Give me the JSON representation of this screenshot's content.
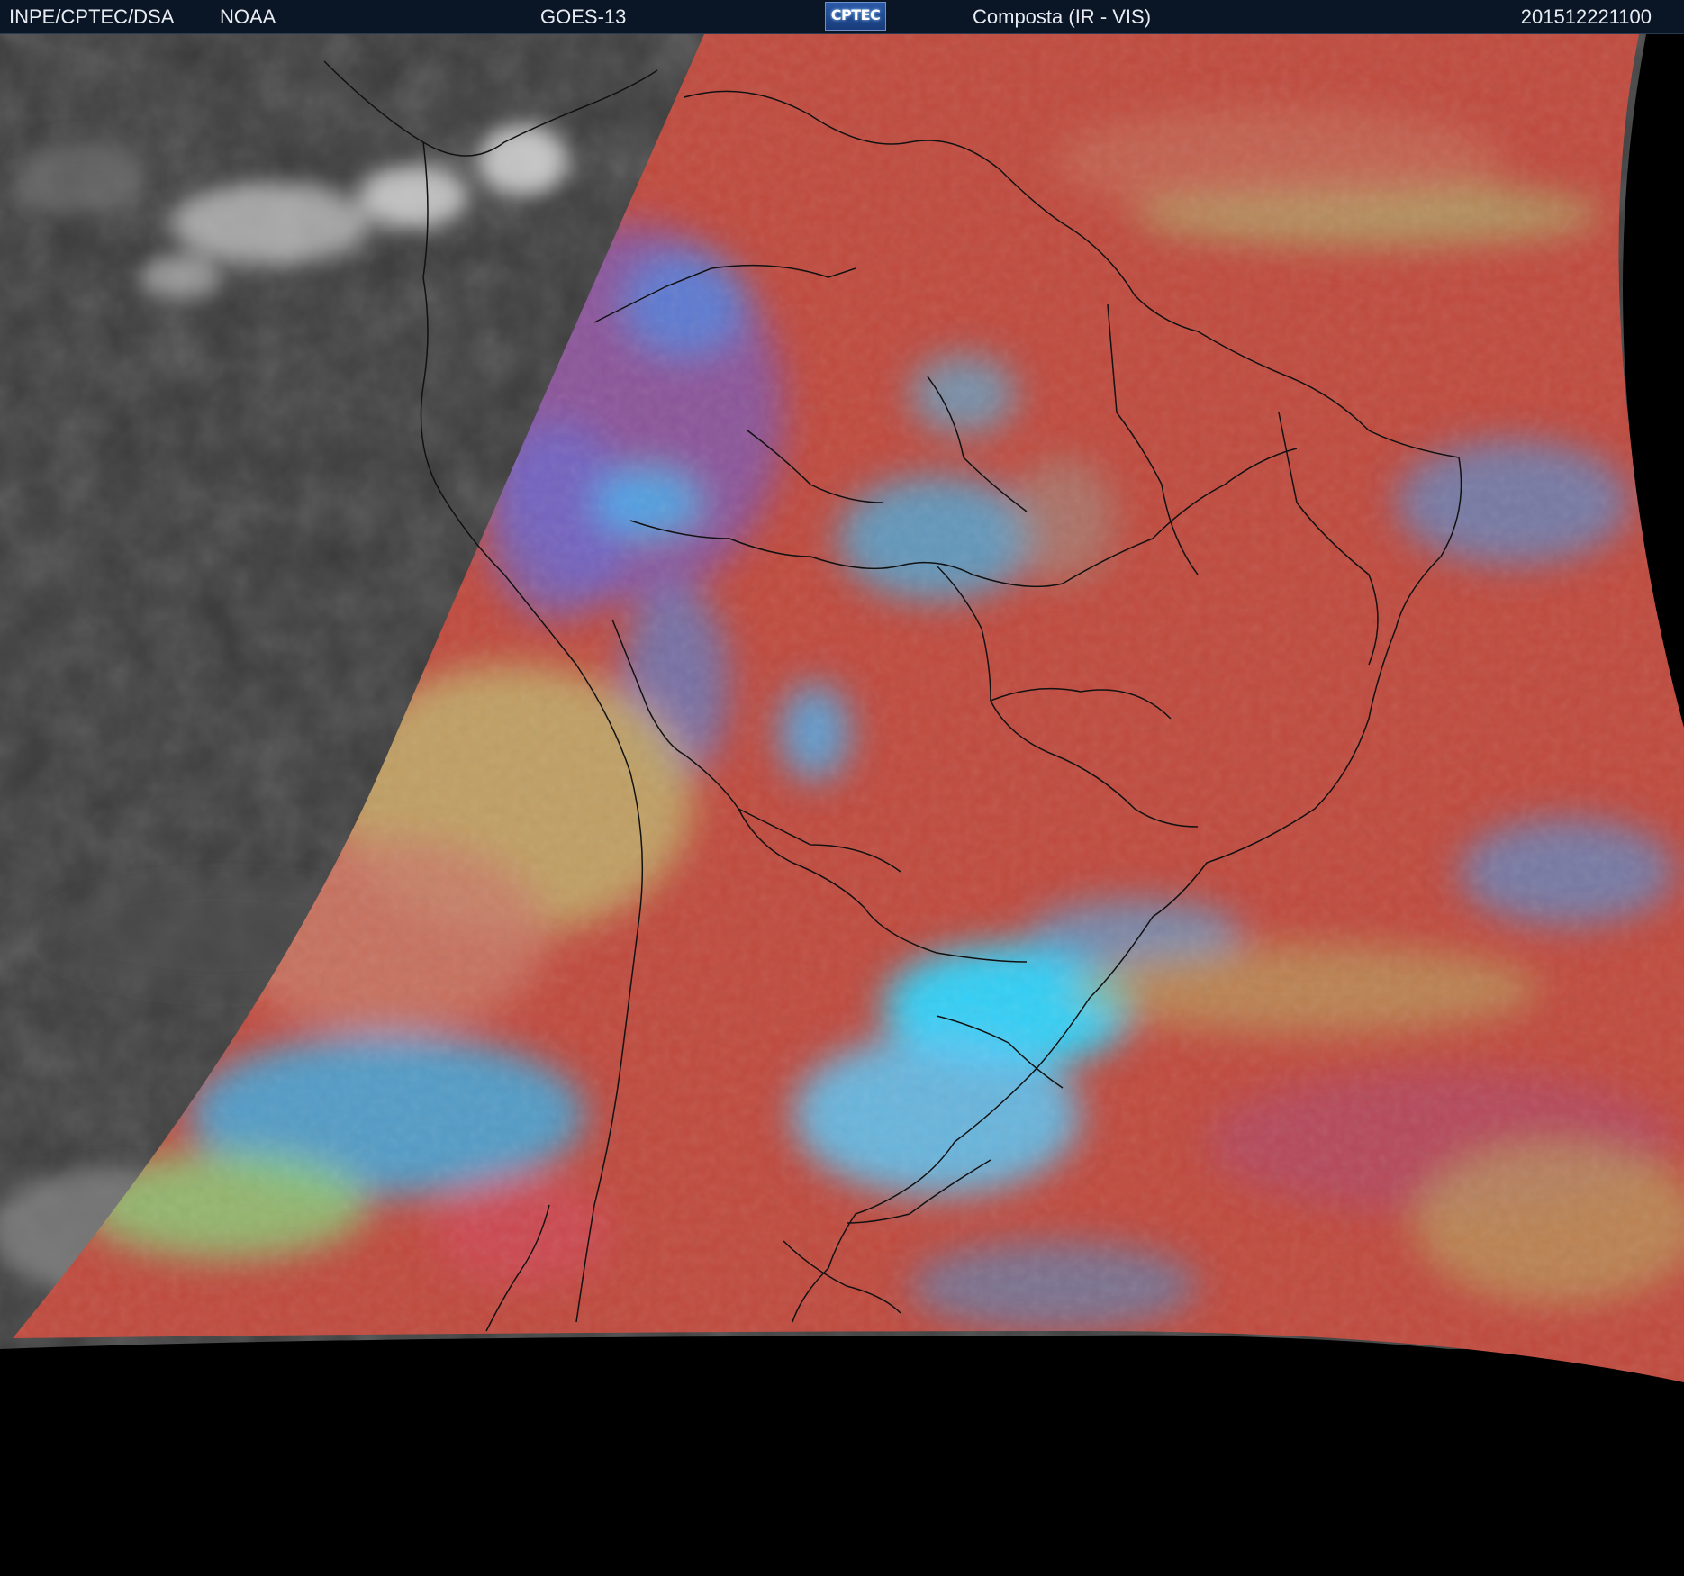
{
  "header": {
    "org": "INPE/CPTEC/DSA",
    "agency": "NOAA",
    "satellite": "GOES-13",
    "logo_text": "CPTEC",
    "product": "Composta (IR - VIS)",
    "timestamp": "201512221100"
  },
  "map": {
    "region": "South America",
    "colors": {
      "night_ir": "#3a3a3a",
      "day_composite": "#c04a3e",
      "cold_cloud_cyan": "#2cc6ff",
      "cloud_blue": "#4a8ae8",
      "green_cloud": "#a6d07a",
      "low_cloud_yellow": "#c0a868",
      "space": "#000000",
      "borders": "#111111"
    }
  }
}
